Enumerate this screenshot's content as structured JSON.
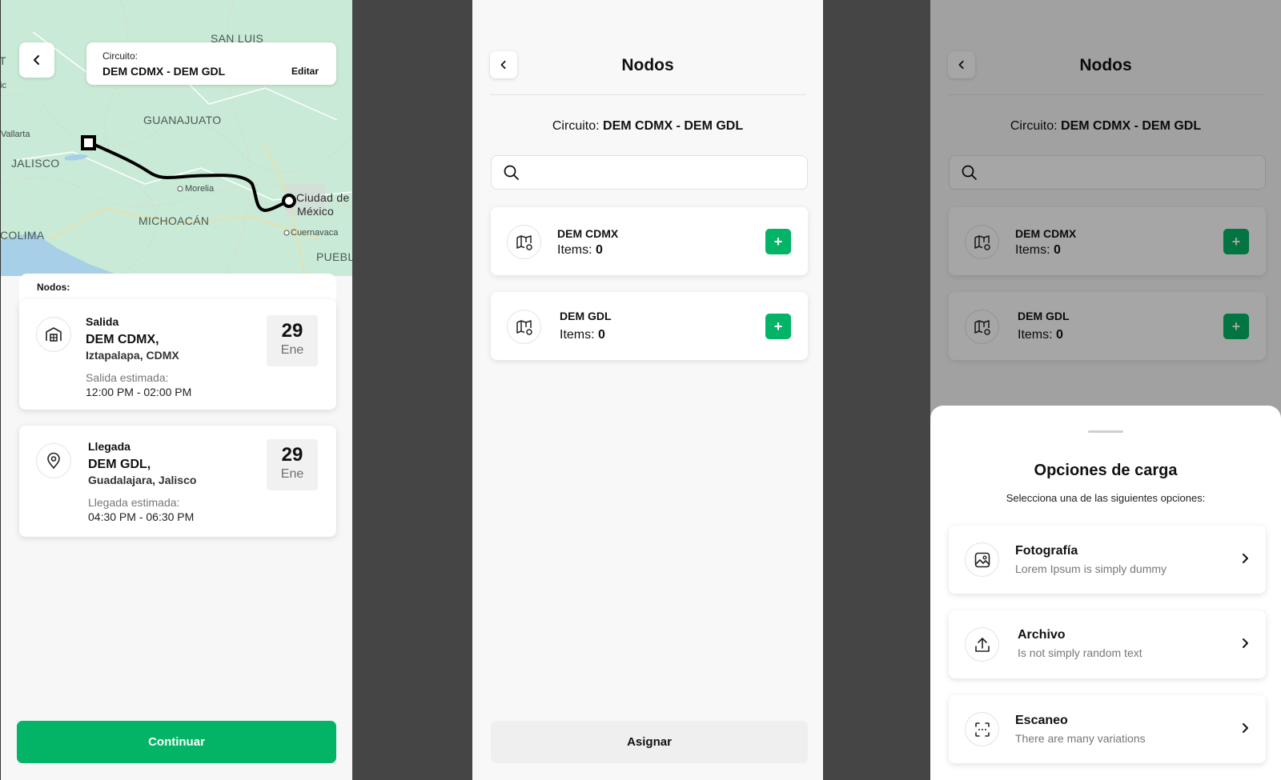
{
  "route_screen": {
    "map_labels": {
      "san_luis": "SAN LUIS",
      "guanajuato": "GUANAJUATO",
      "vallarta": "Vallarta",
      "jalisco": "JALISCO",
      "morelia": "Morelia",
      "ciudad1": "Ciudad de",
      "ciudad2": "México",
      "michoacan": "MICHOACÁN",
      "colima": "COLIMA",
      "cuernavaca": "Cuernavaca",
      "puebla": "PUEBL",
      "edge_t": "T",
      "edge_ic": "ic"
    },
    "circuit_label": "Circuito:",
    "circuit_value": "DEM CDMX - DEM GDL",
    "edit_label": "Editar",
    "nodes_label": "Nodos:",
    "departure": {
      "title": "Salida",
      "name": "DEM CDMX,",
      "city": "Iztapalapa, CDMX",
      "estimate_label": "Salida estimada:",
      "time": "12:00 PM - 02:00 PM",
      "day": "29",
      "month": "Ene",
      "icon": "warehouse-icon"
    },
    "arrival": {
      "title": "Llegada",
      "name": "DEM GDL,",
      "city": "Guadalajara, Jalisco",
      "estimate_label": "Llegada estimada:",
      "time": "04:30 PM - 06:30 PM",
      "day": "29",
      "month": "Ene",
      "icon": "location-pin-icon"
    },
    "continue_label": "Continuar",
    "accent": "#04b466"
  },
  "nodes_screen": {
    "title": "Nodos",
    "circuit_prefix": "Circuito:",
    "circuit_value": "DEM CDMX - DEM GDL",
    "search_placeholder": "",
    "items_label": "Items:",
    "nodes": [
      {
        "name": "DEM CDMX",
        "items": "0"
      },
      {
        "name": "DEM GDL",
        "items": "0"
      }
    ],
    "plus_label": "+",
    "assign_label": "Asignar"
  },
  "options_sheet": {
    "title": "Opciones de carga",
    "subtitle": "Selecciona una de las siguientes opciones:",
    "options": [
      {
        "title": "Fotografía",
        "desc": "Lorem Ipsum is simply dummy",
        "icon": "image-icon"
      },
      {
        "title": "Archivo",
        "desc": "Is not simply random text",
        "icon": "upload-icon"
      },
      {
        "title": "Escaneo",
        "desc": "There are many variations",
        "icon": "scan-icon"
      }
    ]
  }
}
